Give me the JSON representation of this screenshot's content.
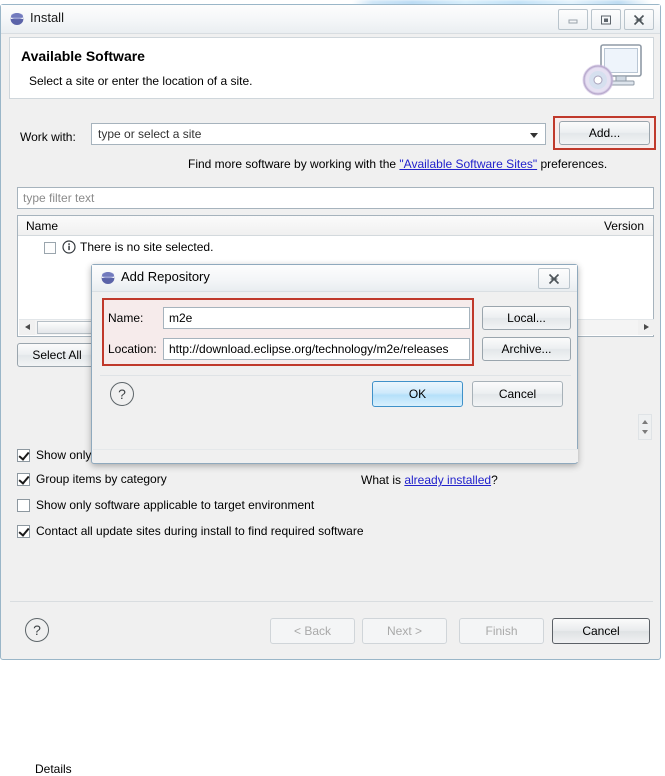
{
  "window": {
    "title": "Install",
    "icon": "eclipse-globe-icon",
    "controls": {
      "minimize": "minimize-icon",
      "maximize": "maximize-icon",
      "close": "close-icon"
    }
  },
  "header": {
    "title": "Available Software",
    "subtitle": "Select a site or enter the location of a site.",
    "art_icon": "monitor-disc-icon"
  },
  "work_with": {
    "label": "Work with:",
    "combo_value": "type or select a site",
    "add_button": "Add...",
    "hint_prefix": "Find more software by working with the ",
    "hint_link": "\"Available Software Sites\"",
    "hint_suffix": " preferences."
  },
  "filter": {
    "placeholder": "type filter text"
  },
  "tree": {
    "columns": [
      "Name",
      "Version"
    ],
    "rows": [
      {
        "checked": false,
        "icon": "info-icon",
        "name": "There is no site selected.",
        "version": ""
      }
    ]
  },
  "buttons": {
    "select_all": "Select All"
  },
  "details": {
    "label": "Details"
  },
  "options": [
    {
      "label": "Show only the latest versions of available software",
      "checked": true
    },
    {
      "label": "Group items by category",
      "checked": true
    },
    {
      "label": "Show only software applicable to target environment",
      "checked": false
    },
    {
      "label": "Contact all update sites during install to find required software",
      "checked": true
    }
  ],
  "what_is": {
    "prefix": "What is ",
    "link": "already installed",
    "suffix": "?"
  },
  "wizard_buttons": {
    "help": "help-icon",
    "back": "< Back",
    "next": "Next >",
    "finish": "Finish",
    "cancel": "Cancel"
  },
  "add_repository": {
    "title": "Add Repository",
    "icon": "eclipse-globe-icon",
    "close": "close-icon",
    "name_label": "Name:",
    "name_value": "m2e",
    "location_label": "Location:",
    "location_value": "http://download.eclipse.org/technology/m2e/releases",
    "local_button": "Local...",
    "archive_button": "Archive...",
    "ok_button": "OK",
    "cancel_button": "Cancel",
    "help": "help-icon"
  },
  "colors": {
    "annotation_red": "#c0392b",
    "link_blue": "#2222cc",
    "default_button_blue": "#b5e0fa",
    "window_chrome": "#f0f0f0"
  }
}
